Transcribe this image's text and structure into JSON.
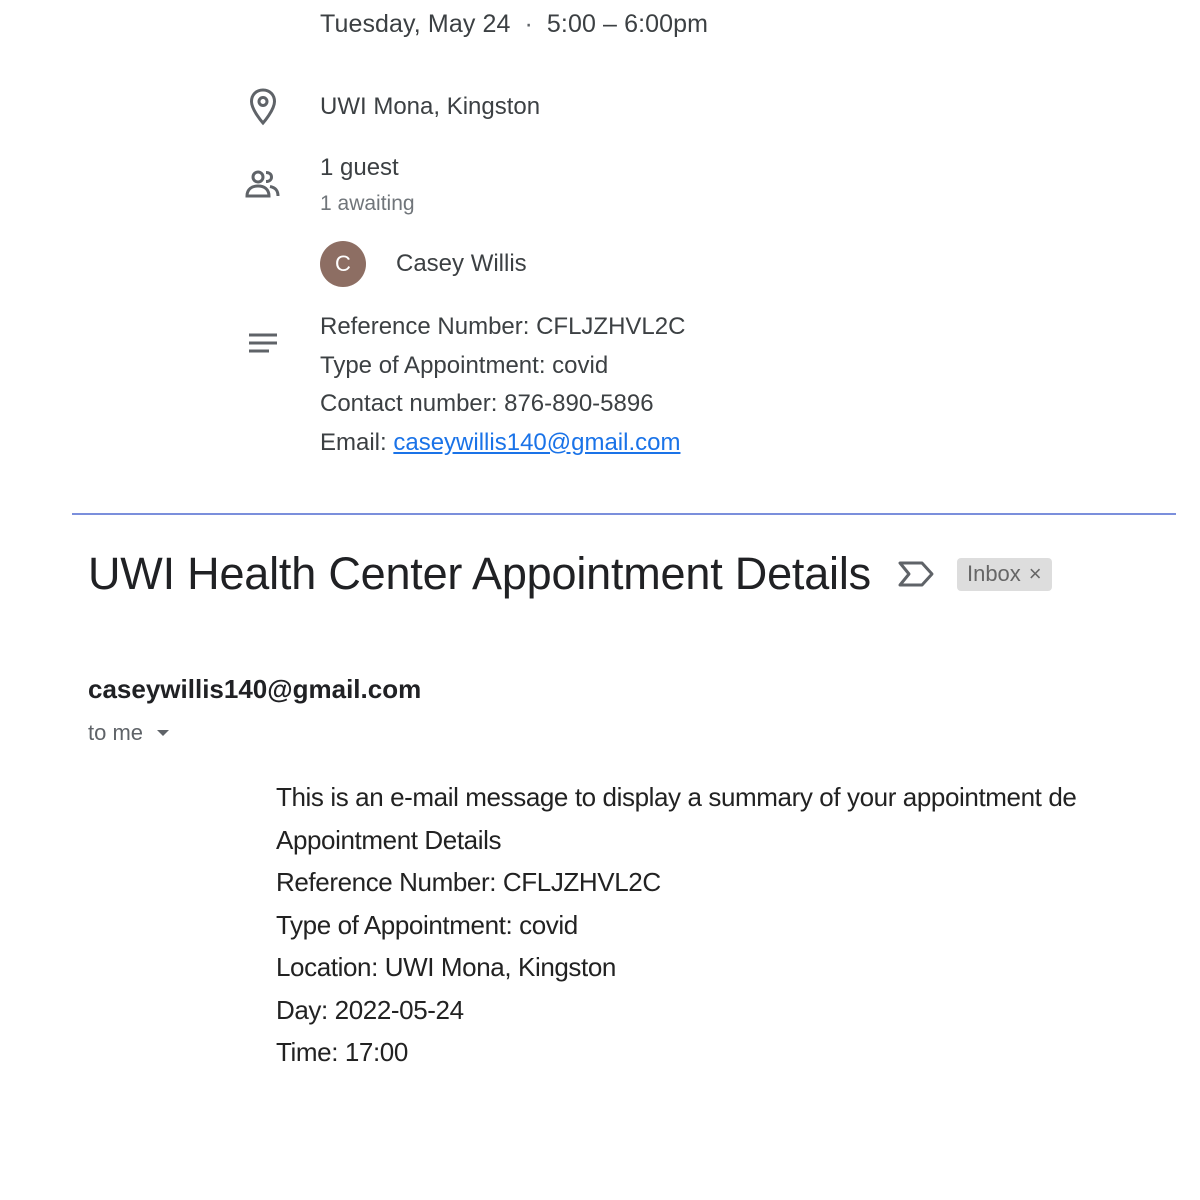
{
  "event": {
    "date": "Tuesday, May 24",
    "separator": "·",
    "time": "5:00 – 6:00pm",
    "location": "UWI Mona, Kingston",
    "guests_count": "1 guest",
    "guests_status": "1 awaiting",
    "guest": {
      "initial": "C",
      "name": "Casey Willis",
      "avatar_color": "#8d6e63"
    },
    "description": {
      "reference": "Reference Number: CFLJZHVL2C",
      "type": "Type of Appointment: covid",
      "contact": "Contact number: 876-890-5896",
      "email_label": "Email: ",
      "email_link": "caseywillis140@gmail.com"
    },
    "icons": [
      "location-pin-icon",
      "people-icon",
      "description-lines-icon"
    ]
  },
  "email": {
    "subject": "UWI Health Center Appointment Details",
    "label": "Inbox",
    "label_close": "×",
    "sender": "caseywillis140@gmail.com",
    "recipient": "to me",
    "body": [
      "This is an e-mail message to display a summary of your appointment de",
      "Appointment Details",
      "Reference Number: CFLJZHVL2C",
      "Type of Appointment: covid",
      "Location: UWI Mona, Kingston",
      "Day: 2022-05-24",
      "Time: 17:00"
    ]
  },
  "colors": {
    "link": "#1a73e8",
    "divider": "#7b8fdc",
    "label_chip": "#dddddd"
  }
}
